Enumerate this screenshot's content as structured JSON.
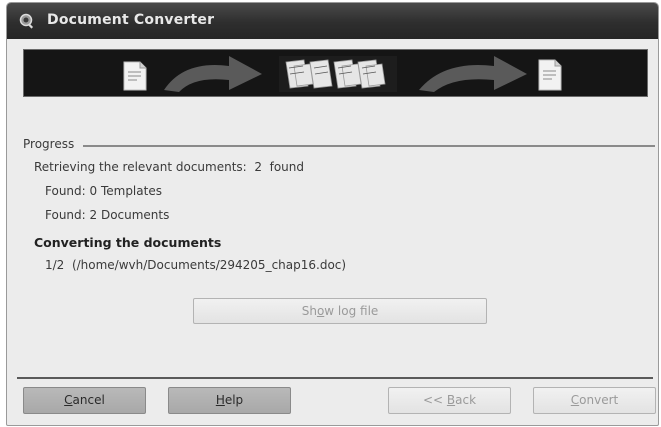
{
  "window": {
    "title": "Document Converter",
    "title_icon": "converter-app-icon"
  },
  "banner": {
    "icons": [
      "source-document-icon",
      "arrow-right-icon",
      "documents-batch-icon",
      "arrow-right-icon",
      "target-document-icon"
    ]
  },
  "progress": {
    "label": "Progress",
    "retrieving_text": "Retrieving the relevant documents:  2  found",
    "found_templates": "Found: 0 Templates",
    "found_documents": "Found: 2 Documents",
    "converting_heading": "Converting the documents",
    "current_file": "1/2  (/home/wvh/Documents/294205_chap16.doc)"
  },
  "buttons": {
    "show_log": {
      "pre": "Sh",
      "mnemonic": "o",
      "post": "w log file"
    },
    "cancel": {
      "pre": "",
      "mnemonic": "C",
      "post": "ancel"
    },
    "help": {
      "pre": "",
      "mnemonic": "H",
      "post": "elp"
    },
    "back": {
      "pre": "<< ",
      "mnemonic": "B",
      "post": "ack"
    },
    "convert": {
      "pre": "",
      "mnemonic": "C",
      "post": "onvert"
    }
  }
}
